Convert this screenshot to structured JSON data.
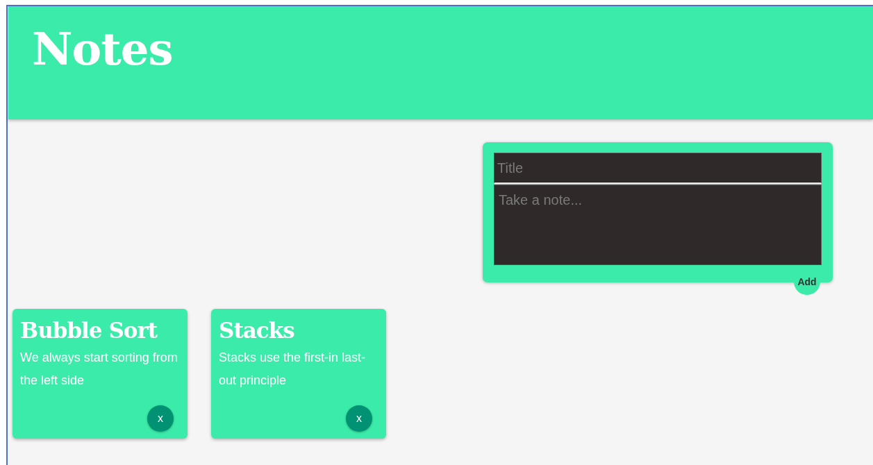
{
  "header": {
    "title": "Notes"
  },
  "form": {
    "title_placeholder": "Title",
    "content_placeholder": "Take a note...",
    "add_button": "Add"
  },
  "notes": [
    {
      "title": "Bubble Sort",
      "content": "We always start sorting from the left side",
      "delete_button": "x"
    },
    {
      "title": "Stacks",
      "content": "Stacks use the first-in last-out principle",
      "delete_button": "x"
    }
  ]
}
